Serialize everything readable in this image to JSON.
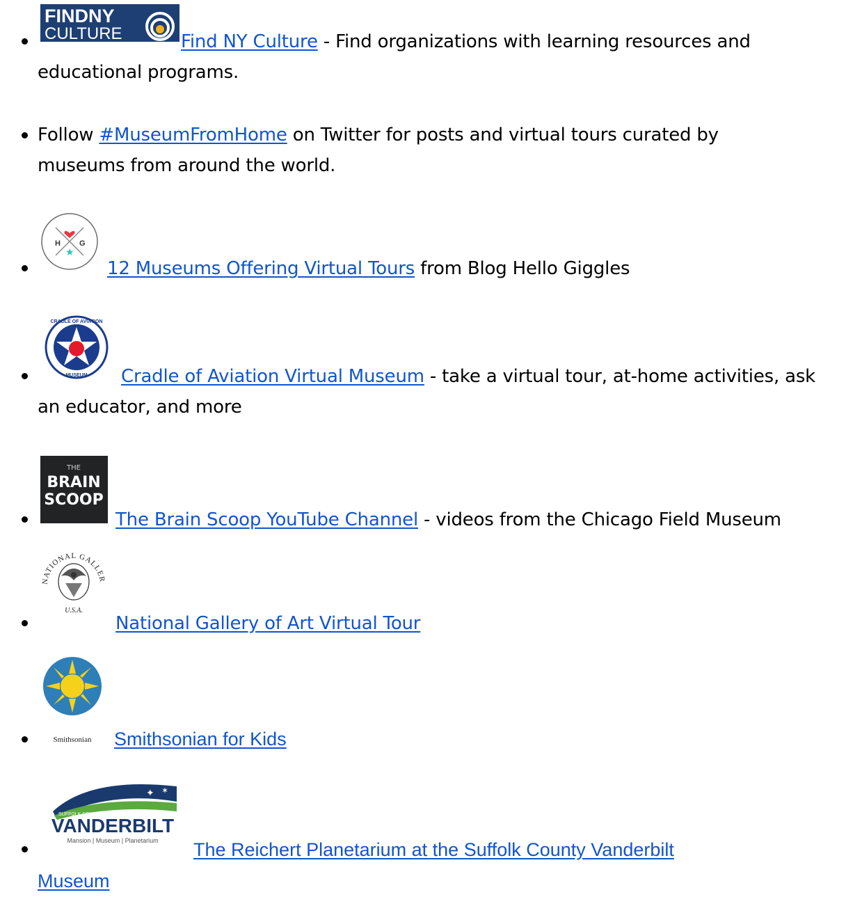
{
  "items": [
    {
      "logo": {
        "name": "findny-culture-logo",
        "line1": "FINDNY",
        "line2": "CULTURE"
      },
      "link": "Find NY Culture",
      "text": " - Find organizations with learning resources and",
      "text2": "educational programs."
    },
    {
      "pre": "Follow ",
      "link": "#MuseumFromHome",
      "text": " on Twitter for posts and virtual tours curated by",
      "text2": "museums from around the world."
    },
    {
      "logo": {
        "name": "hello-giggles-logo",
        "left": "H",
        "right": "G"
      },
      "link": "12 Museums Offering Virtual Tours",
      "text": " from Blog Hello Giggles"
    },
    {
      "logo": {
        "name": "cradle-of-aviation-logo",
        "top": "CRADLE OF AVIATION",
        "bottom": "MUSEUM"
      },
      "link": "Cradle of Aviation Virtual Museum",
      "text": " - take a virtual tour, at-home activities, ask",
      "text2": "an educator, and more"
    },
    {
      "logo": {
        "name": "brain-scoop-logo",
        "l1": "THE",
        "l2": "BRAIN",
        "l3": "SCOOP"
      },
      "link": "The Brain Scoop YouTube Channel",
      "text": " - videos from the Chicago Field Museum"
    },
    {
      "logo": {
        "name": "national-gallery-seal",
        "ring": "NATIONAL GALLERY OF ART",
        "bottom": "U.S.A."
      },
      "link": "National Gallery of Art Virtual Tour"
    },
    {
      "logo": {
        "name": "smithsonian-logo",
        "caption": "Smithsonian"
      },
      "link": "Smithsonian for Kids"
    },
    {
      "logo": {
        "name": "vanderbilt-logo",
        "top": "SUFFOLK COUNTY",
        "word": "VANDERBILT",
        "sub": "Mansion | Museum | Planetarium"
      },
      "link": "The Reichert Planetarium at the Suffolk County Vanderbilt",
      "link2": "Museum"
    }
  ],
  "colors": {
    "link": "#1155cc",
    "text": "#000000"
  }
}
